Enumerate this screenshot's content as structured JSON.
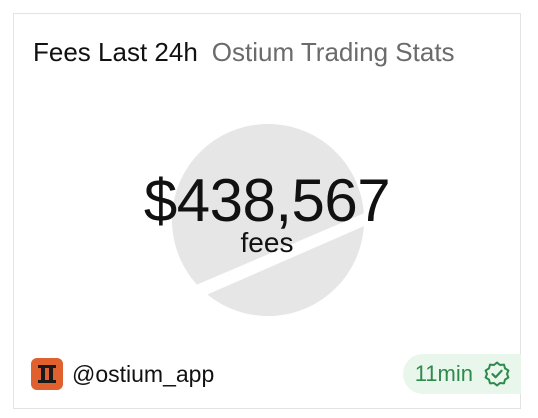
{
  "widget": {
    "title": "Fees Last 24h",
    "subtitle": "Ostium Trading Stats",
    "value": "$438,567",
    "value_label": "fees"
  },
  "footer": {
    "avatar_icon": "ostium-logo-icon",
    "handle": "@ostium_app",
    "updated": "11min",
    "verified_icon": "verified-check-icon"
  },
  "colors": {
    "logo_watermark": "#e6e6e6",
    "avatar_bg": "#e0602e",
    "badge_bg": "#e9f6ec",
    "badge_text": "#2f8a4c"
  }
}
